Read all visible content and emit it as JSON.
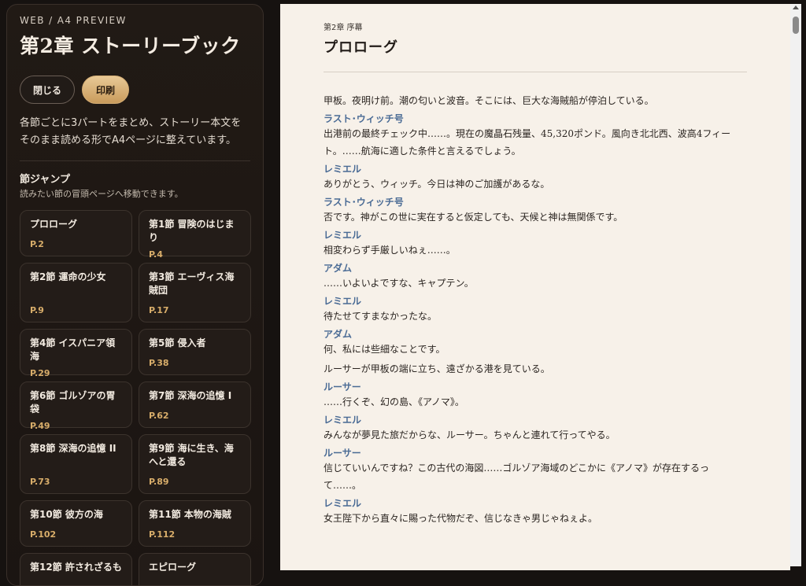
{
  "sidebar": {
    "kicker": "WEB / A4 PREVIEW",
    "title": "第2章 ストーリーブック",
    "buttons": {
      "close": "閉じる",
      "print": "印刷"
    },
    "description": "各節ごとに3パートをまとめ、ストーリー本文をそのまま読める形でA4ページに整えています。",
    "jump": {
      "title": "節ジャンプ",
      "subtitle": "読みたい節の冒頭ページへ移動できます。",
      "sections": [
        {
          "title": "プロローグ",
          "page": "P.2"
        },
        {
          "title": "第1節 冒険のはじまり",
          "page": "P.4"
        },
        {
          "title": "第2節 運命の少女",
          "page": "P.9"
        },
        {
          "title": "第3節 エーヴィス海賊団",
          "page": "P.17"
        },
        {
          "title": "第4節 イスパニア領海",
          "page": "P.29"
        },
        {
          "title": "第5節 侵入者",
          "page": "P.38"
        },
        {
          "title": "第6節 ゴルゾアの胃袋",
          "page": "P.49"
        },
        {
          "title": "第7節 深海の追憶 I",
          "page": "P.62"
        },
        {
          "title": "第8節 深海の追憶 II",
          "page": "P.73"
        },
        {
          "title": "第9節 海に生き、海へと還る",
          "page": "P.89"
        },
        {
          "title": "第10節 彼方の海",
          "page": "P.102"
        },
        {
          "title": "第11節 本物の海賊",
          "page": "P.112"
        },
        {
          "title": "第12節 許されざるも",
          "page": ""
        },
        {
          "title": "エピローグ",
          "page": ""
        }
      ]
    }
  },
  "page": {
    "chapter_label": "第2章 序幕",
    "title": "プロローグ",
    "narration_1": "甲板。夜明け前。潮の匂いと波音。そこには、巨大な海賊船が停泊している。",
    "dialogue_1": [
      {
        "speaker": "ラスト･ウィッチ号",
        "text": "出港前の最終チェック中……。現在の魔晶石残量、45,320ポンド。風向き北北西、波高4フィート。……航海に適した条件と言えるでしょう。"
      },
      {
        "speaker": "レミエル",
        "text": "ありがとう、ウィッチ。今日は神のご加護があるな。"
      },
      {
        "speaker": "ラスト･ウィッチ号",
        "text": "否です。神がこの世に実在すると仮定しても、天候と神は無関係です。"
      },
      {
        "speaker": "レミエル",
        "text": "相変わらず手厳しいねぇ……。"
      },
      {
        "speaker": "アダム",
        "text": "……いよいよですな、キャプテン。"
      },
      {
        "speaker": "レミエル",
        "text": "待たせてすまなかったな。"
      },
      {
        "speaker": "アダム",
        "text": "何、私には些細なことです。"
      }
    ],
    "narration_2": "ルーサーが甲板の端に立ち、遠ざかる港を見ている。",
    "dialogue_2": [
      {
        "speaker": "ルーサー",
        "text": "……行くぞ、幻の島、《アノマ》。"
      },
      {
        "speaker": "レミエル",
        "text": "みんなが夢見た旅だからな、ルーサー。ちゃんと連れて行ってやる。"
      },
      {
        "speaker": "ルーサー",
        "text": "信じていいんですね？この古代の海図……ゴルゾア海域のどこかに《アノマ》が存在するって……。"
      },
      {
        "speaker": "レミエル",
        "text": "女王陛下から直々に賜った代物だぞ、信じなきゃ男じゃねぇよ。"
      }
    ]
  }
}
